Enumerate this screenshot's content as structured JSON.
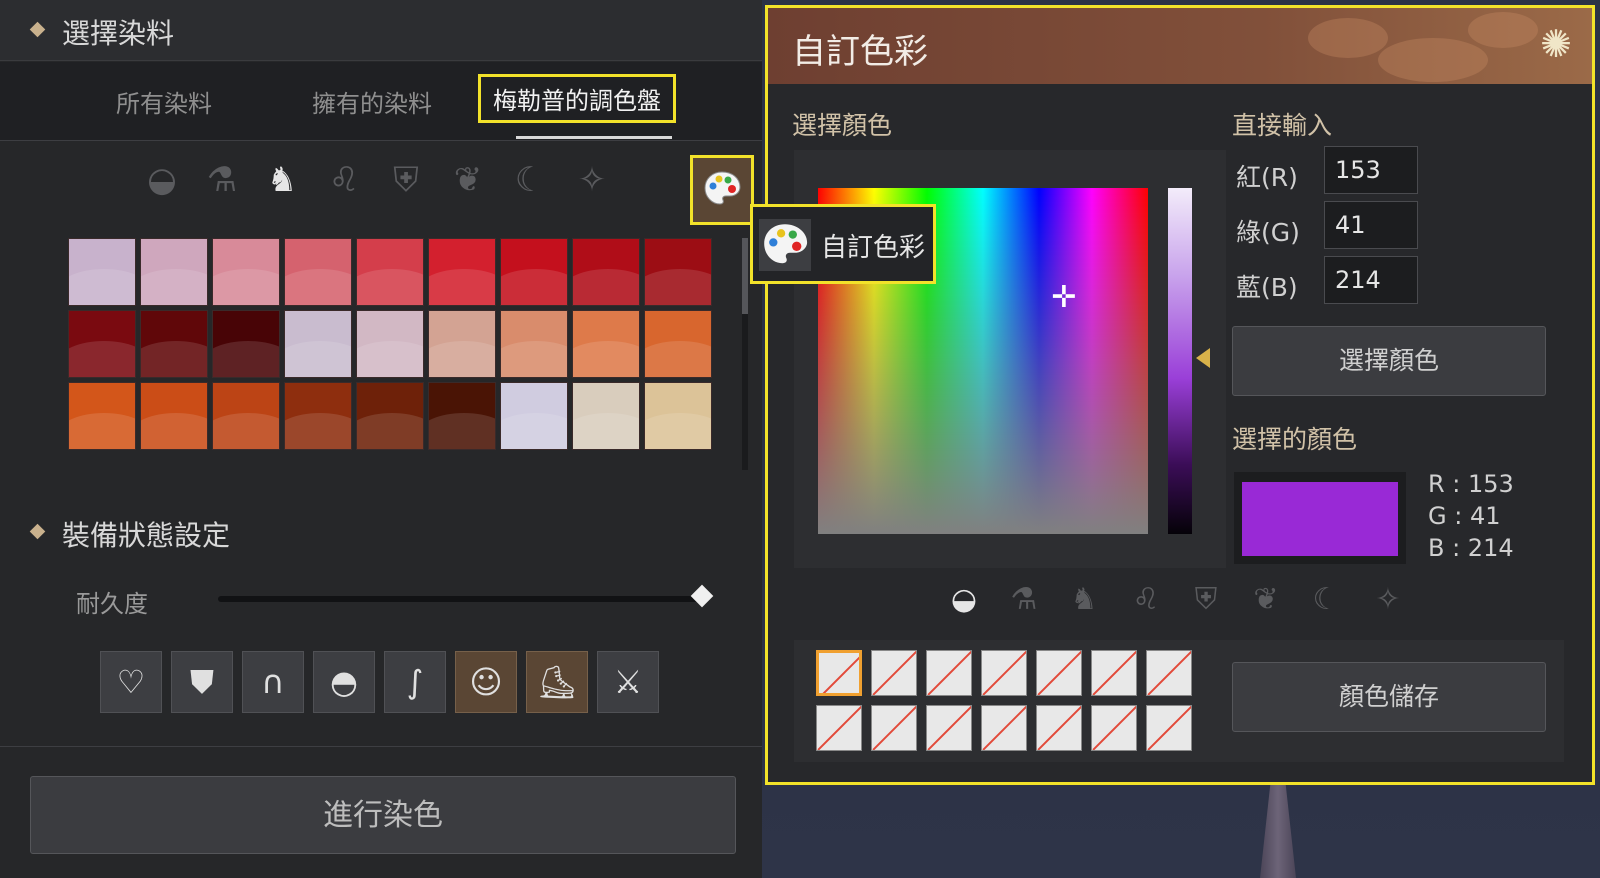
{
  "left": {
    "section_dye_title": "選擇染料",
    "tabs": [
      "所有染料",
      "擁有的染料",
      "梅勒普的調色盤"
    ],
    "category_icons": [
      "bucket-icon",
      "flask-icon",
      "horse-icon",
      "lion-icon",
      "shield-icon",
      "eagle-icon",
      "moon-icon",
      "star-eye-icon"
    ],
    "palette_button_icon": "palette-icon",
    "swatches": [
      "#c8b2cc",
      "#cfa7bd",
      "#d88a99",
      "#d5626e",
      "#d43e4b",
      "#d3202e",
      "#c4101d",
      "#b00d18",
      "#9c0d14",
      "#7a0a10",
      "#600709",
      "#480406",
      "#c9bccf",
      "#d2b8c4",
      "#d3a393",
      "#d98c6c",
      "#de7a4a",
      "#d8662e",
      "#d3561a",
      "#cb4d17",
      "#bc4415",
      "#8e2e0e",
      "#6e2109",
      "#4a1405",
      "#d0cce0",
      "#d9cdbd",
      "#dcc398"
    ],
    "section_equip_title": "裝備狀態設定",
    "durability_label": "耐久度",
    "durability_value": 1.0,
    "equip_icons": [
      "bra-icon",
      "armor-icon",
      "hood-icon",
      "helmet-icon",
      "hair-icon",
      "character-icon",
      "boots-icon",
      "weapon-icon"
    ],
    "equip_active": [
      false,
      false,
      false,
      false,
      false,
      true,
      true,
      false
    ],
    "dye_button": "進行染色"
  },
  "panel": {
    "title": "自訂色彩",
    "close_icon": "flower-icon",
    "pick_color_label": "選擇顏色",
    "direct_input_label": "直接輸入",
    "red_label": "紅(R)",
    "green_label": "綠(G)",
    "blue_label": "藍(B)",
    "red_value": "153",
    "green_value": "41",
    "blue_value": "214",
    "pick_color_button": "選擇顏色",
    "selected_color_label": "選擇的顏色",
    "selected_color": "#9929d6",
    "readout_r": "R : 153",
    "readout_g": "G : 41",
    "readout_b": "B : 214",
    "tooltip_label": "自訂色彩",
    "category_icons": [
      "bucket-icon",
      "flask-icon",
      "horse-icon",
      "lion-icon",
      "shield-icon",
      "eagle-icon",
      "moon-icon",
      "star-eye-icon"
    ],
    "save_button": "顏色儲存",
    "slot_count": 14
  }
}
